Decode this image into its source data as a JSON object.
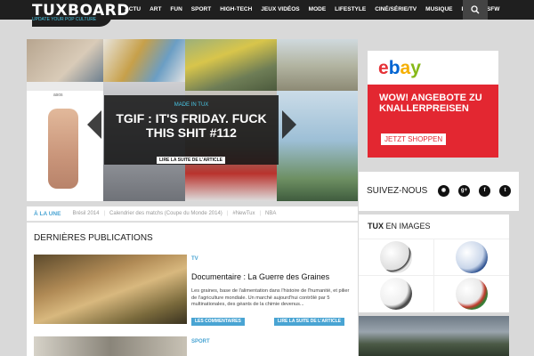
{
  "logo": {
    "name": "TUXBOARD",
    "tagline": "UPDATE YOUR POP CULTURE"
  },
  "nav": [
    "ACTU",
    "ART",
    "FUN",
    "SPORT",
    "HIGH-TECH",
    "JEUX VIDÉOS",
    "MODE",
    "LIFESTYLE",
    "CINÉ/SÉRIE/TV",
    "MUSIQUE",
    "PUB",
    "NSFW"
  ],
  "feature": {
    "category": "MADE IN TUX",
    "title": "TGIF : IT'S FRIDAY. FUCK THIS SHIT #112",
    "more": "LIRE LA SUITE DE L'ARTICLE",
    "asos_text": "asos"
  },
  "tagbar": {
    "active": "À LA UNE",
    "tags": [
      "Brésil 2014",
      "Calendrier des matchs (Coupe du Monde 2014)",
      "#NewTux",
      "NBA"
    ]
  },
  "main": {
    "heading": "DERNIÈRES PUBLICATIONS",
    "post": {
      "category": "TV",
      "title": "Documentaire : La Guerre des Graines",
      "excerpt": "Les graines, base de l'alimentation dans l'histoire de l'humanité, et pilier de l'agriculture mondiale. Un marché aujourd'hui contrôlé par 5 multinationales, des géants de la chimie devenus...",
      "comments": "LES COMMENTAIRES",
      "more": "LIRE LA SUITE DE L'ARTICLE"
    },
    "post2": {
      "category": "SPORT"
    }
  },
  "ad": {
    "brand": "ebay",
    "headline": "WOW! ANGEBOTE ZU KNALLERPREISEN",
    "cta": "JETZT SHOPPEN"
  },
  "follow": {
    "label": "SUIVEZ-NOUS",
    "icons": [
      "rss-icon",
      "google-plus-icon",
      "facebook-icon",
      "twitter-icon"
    ]
  },
  "images": {
    "heading_bold": "TUX",
    "heading_rest": "EN IMAGES"
  },
  "colors": {
    "accent": "#49a4d3",
    "topbar": "#1f1f1f",
    "ebay_red": "#e32731"
  }
}
